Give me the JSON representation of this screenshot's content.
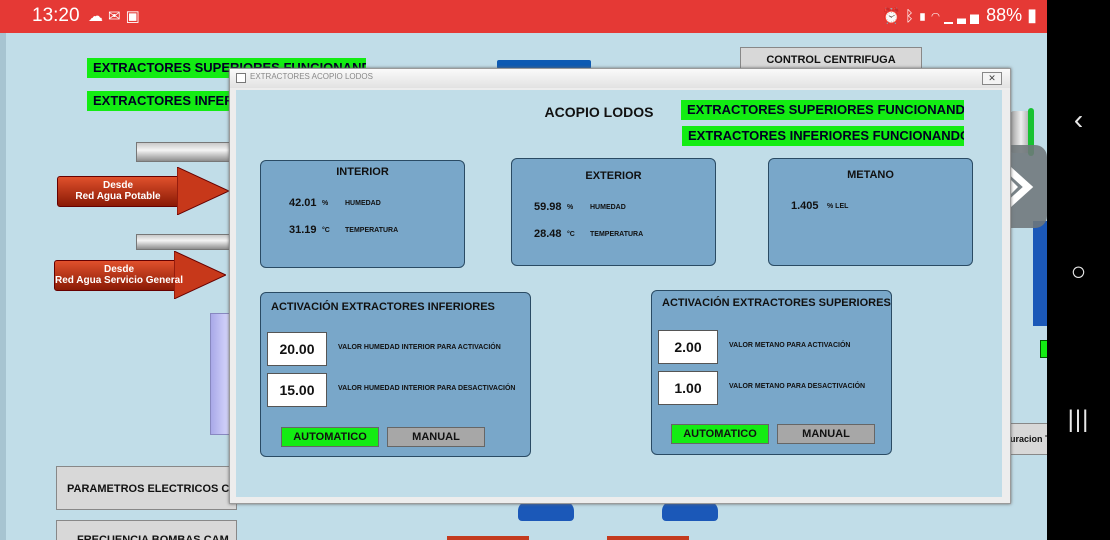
{
  "status_bar": {
    "time": "13:20",
    "battery": "88%"
  },
  "background": {
    "top_labels": [
      "EXTRACTORES SUPERIORES FUNCIONANDO",
      "EXTRACTORES INFERIORES FUNCIONANDO"
    ],
    "control_centrifuga": "CONTROL CENTRIFUGA",
    "arrow_1": {
      "line1": "Desde",
      "line2": "Red Agua Potable"
    },
    "arrow_2": {
      "line1": "Desde",
      "line2": "Red Agua Servicio General"
    },
    "parametros_button": "PARAMETROS ELECTRICOS CAVITADOR",
    "frecuencia_button": "FRECUENCIA BOMBAS CAM",
    "right_partial_button": "uracion T"
  },
  "dialog": {
    "window_title": "EXTRACTORES ACOPIO LODOS",
    "close_label": "✕",
    "heading": "ACOPIO LODOS",
    "status_superiores": "EXTRACTORES SUPERIORES FUNCIONANDO",
    "status_inferiores": "EXTRACTORES INFERIORES FUNCIONANDO",
    "interior": {
      "title": "INTERIOR",
      "humidity_value": "42.01",
      "humidity_unit": "%",
      "humidity_label": "HUMEDAD",
      "temp_value": "31.19",
      "temp_unit": "°C",
      "temp_label": "TEMPERATURA"
    },
    "exterior": {
      "title": "EXTERIOR",
      "humidity_value": "59.98",
      "humidity_unit": "%",
      "humidity_label": "HUMEDAD",
      "temp_value": "28.48",
      "temp_unit": "°C",
      "temp_label": "TEMPERATURA"
    },
    "metano": {
      "title": "METANO",
      "value": "1.405",
      "unit": "% LEL"
    },
    "inferiores": {
      "title": "ACTIVACIÓN EXTRACTORES INFERIORES",
      "activation_value": "20.00",
      "activation_label": "VALOR HUMEDAD INTERIOR PARA ACTIVACIÓN",
      "deactivation_value": "15.00",
      "deactivation_label": "VALOR HUMEDAD INTERIOR PARA DESACTIVACIÓN",
      "auto_label": "AUTOMATICO",
      "manual_label": "MANUAL"
    },
    "superiores": {
      "title": "ACTIVACIÓN EXTRACTORES SUPERIORES",
      "activation_value": "2.00",
      "activation_label": "VALOR METANO PARA ACTIVACIÓN",
      "deactivation_value": "1.00",
      "deactivation_label": "VALOR METANO PARA DESACTIVACIÓN",
      "auto_label": "AUTOMATICO",
      "manual_label": "MANUAL"
    }
  },
  "colors": {
    "status_green": "#13ec13",
    "panel_blue": "#79a7c9",
    "background": "#c1dde8",
    "status_bar_red": "#e53935"
  }
}
